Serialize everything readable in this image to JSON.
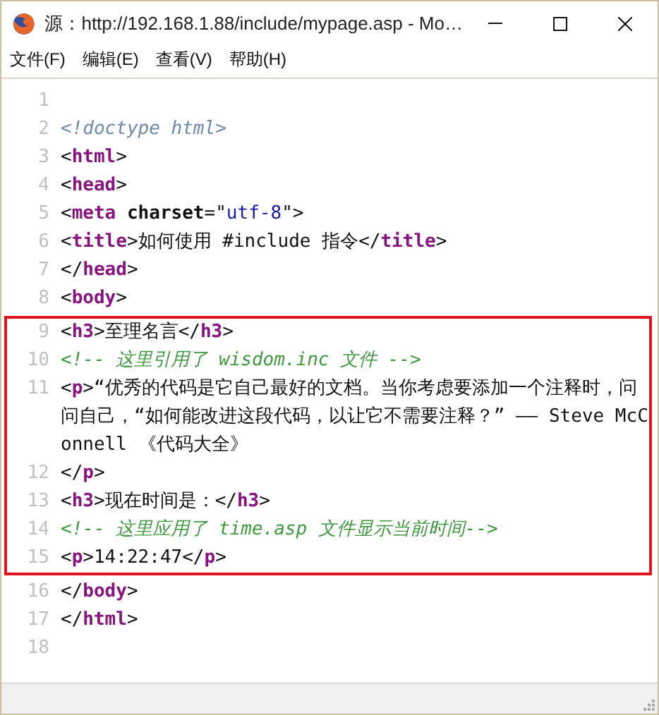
{
  "window": {
    "title": "源：http://192.168.1.88/include/mypage.asp - Mo…"
  },
  "menu": [
    {
      "label": "文件(F)"
    },
    {
      "label": "编辑(E)"
    },
    {
      "label": "查看(V)"
    },
    {
      "label": "帮助(H)"
    }
  ],
  "sections": [
    {
      "boxed": false,
      "lines": [
        {
          "number": "1"
        },
        {
          "number": "2",
          "tokens": [
            {
              "kind": "doctype",
              "text": "<!doctype html>"
            }
          ]
        },
        {
          "number": "3",
          "tokens": [
            {
              "kind": "punct",
              "text": "<"
            },
            {
              "kind": "tag",
              "text": "html"
            },
            {
              "kind": "punct",
              "text": ">"
            }
          ]
        },
        {
          "number": "4",
          "tokens": [
            {
              "kind": "punct",
              "text": "<"
            },
            {
              "kind": "tag",
              "text": "head"
            },
            {
              "kind": "punct",
              "text": ">"
            }
          ]
        },
        {
          "number": "5",
          "tokens": [
            {
              "kind": "punct",
              "text": "<"
            },
            {
              "kind": "tag",
              "text": "meta"
            },
            {
              "kind": "attr",
              "text": " charset"
            },
            {
              "kind": "punct",
              "text": "=\""
            },
            {
              "kind": "value",
              "text": "utf-8"
            },
            {
              "kind": "punct",
              "text": "\">"
            }
          ]
        },
        {
          "number": "6",
          "tokens": [
            {
              "kind": "punct",
              "text": "<"
            },
            {
              "kind": "tag",
              "text": "title"
            },
            {
              "kind": "punct",
              "text": ">"
            },
            {
              "kind": "text",
              "text": "如何使用 #include 指令"
            },
            {
              "kind": "punct",
              "text": "</"
            },
            {
              "kind": "tag",
              "text": "title"
            },
            {
              "kind": "punct",
              "text": ">"
            }
          ]
        },
        {
          "number": "7",
          "tokens": [
            {
              "kind": "punct",
              "text": "</"
            },
            {
              "kind": "tag",
              "text": "head"
            },
            {
              "kind": "punct",
              "text": ">"
            }
          ]
        },
        {
          "number": "8",
          "tokens": [
            {
              "kind": "punct",
              "text": "<"
            },
            {
              "kind": "tag",
              "text": "body"
            },
            {
              "kind": "punct",
              "text": ">"
            }
          ]
        }
      ]
    },
    {
      "boxed": true,
      "lines": [
        {
          "number": "9",
          "tokens": [
            {
              "kind": "punct",
              "text": "<"
            },
            {
              "kind": "tag",
              "text": "h3"
            },
            {
              "kind": "punct",
              "text": ">"
            },
            {
              "kind": "text",
              "text": "至理名言"
            },
            {
              "kind": "punct",
              "text": "</"
            },
            {
              "kind": "tag",
              "text": "h3"
            },
            {
              "kind": "punct",
              "text": ">"
            }
          ]
        },
        {
          "number": "10",
          "tokens": [
            {
              "kind": "comment",
              "text": "<!-- 这里引用了 wisdom.inc 文件 -->"
            }
          ]
        },
        {
          "number": "11",
          "tokens": [
            {
              "kind": "punct",
              "text": "<"
            },
            {
              "kind": "tag",
              "text": "p"
            },
            {
              "kind": "punct",
              "text": ">"
            },
            {
              "kind": "text",
              "text": "“优秀的代码是它自己最好的文档。当你考虑要添加一个注释时，问问自己，“如何能改进这段代码，以让它不需要注释？” —— Steve McConnell 《代码大全》"
            }
          ]
        },
        {
          "number": "12",
          "tokens": [
            {
              "kind": "punct",
              "text": "</"
            },
            {
              "kind": "tag",
              "text": "p"
            },
            {
              "kind": "punct",
              "text": ">"
            }
          ]
        },
        {
          "number": "13",
          "tokens": [
            {
              "kind": "punct",
              "text": "<"
            },
            {
              "kind": "tag",
              "text": "h3"
            },
            {
              "kind": "punct",
              "text": ">"
            },
            {
              "kind": "text",
              "text": "现在时间是："
            },
            {
              "kind": "punct",
              "text": "</"
            },
            {
              "kind": "tag",
              "text": "h3"
            },
            {
              "kind": "punct",
              "text": ">"
            }
          ]
        },
        {
          "number": "14",
          "tokens": [
            {
              "kind": "comment",
              "text": "<!-- 这里应用了 time.asp 文件显示当前时间-->"
            }
          ]
        },
        {
          "number": "15",
          "tokens": [
            {
              "kind": "punct",
              "text": "<"
            },
            {
              "kind": "tag",
              "text": "p"
            },
            {
              "kind": "punct",
              "text": ">"
            },
            {
              "kind": "text",
              "text": "14:22:47"
            },
            {
              "kind": "punct",
              "text": "</"
            },
            {
              "kind": "tag",
              "text": "p"
            },
            {
              "kind": "punct",
              "text": ">"
            }
          ]
        }
      ]
    },
    {
      "boxed": false,
      "lines": [
        {
          "number": "16",
          "tokens": [
            {
              "kind": "punct",
              "text": "</"
            },
            {
              "kind": "tag",
              "text": "body"
            },
            {
              "kind": "punct",
              "text": ">"
            }
          ]
        },
        {
          "number": "17",
          "tokens": [
            {
              "kind": "punct",
              "text": "</"
            },
            {
              "kind": "tag",
              "text": "html"
            },
            {
              "kind": "punct",
              "text": ">"
            }
          ]
        },
        {
          "number": "18"
        }
      ]
    }
  ]
}
